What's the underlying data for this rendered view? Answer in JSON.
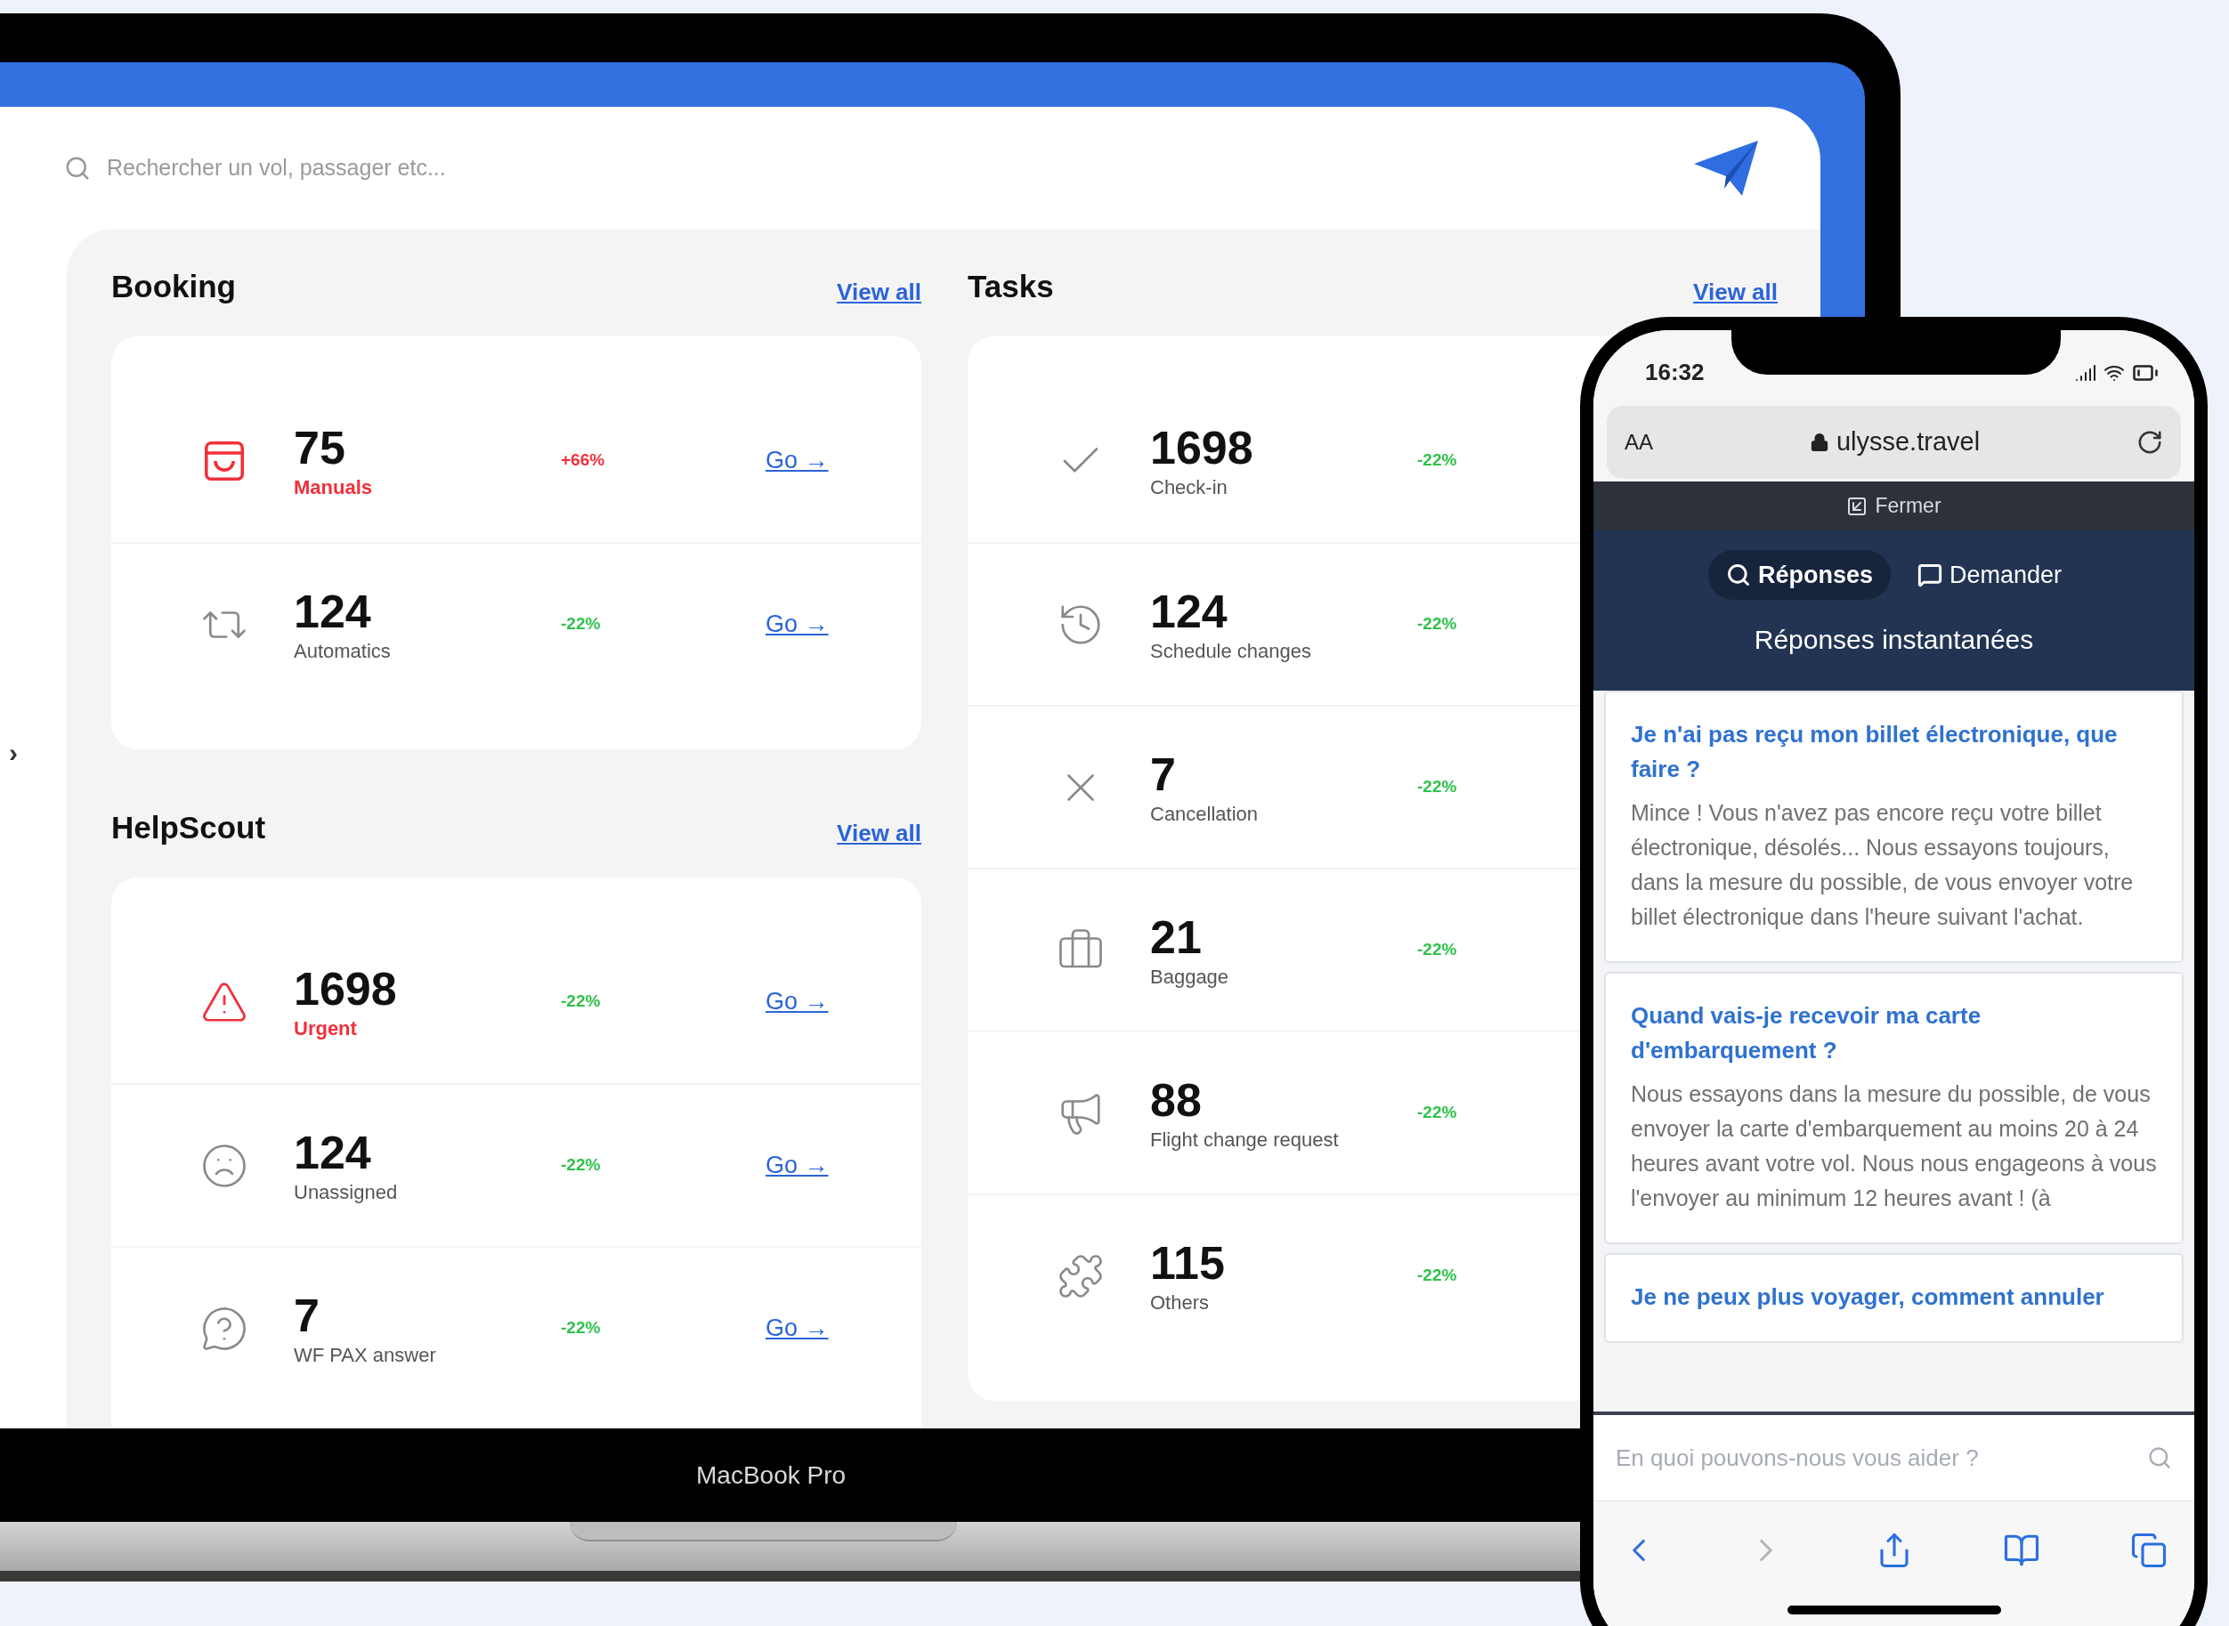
{
  "laptop": {
    "sidebar_toggle": "›",
    "search": {
      "placeholder": "Rechercher un vol, passager etc..."
    },
    "brand_label": "MacBook Pro",
    "columns": [
      [
        {
          "title": "Booking",
          "link": "View all",
          "rows": [
            {
              "value": "75",
              "label": "Manuals",
              "alert": true,
              "change": "+66%",
              "rising": true,
              "link": "Go →"
            },
            {
              "value": "124",
              "label": "Automatics",
              "alert": false,
              "change": "-22%",
              "rising": false,
              "link": "Go →"
            }
          ]
        },
        {
          "title": "HelpScout",
          "link": "View all",
          "rows": [
            {
              "value": "1698",
              "label": "Urgent",
              "alert": true,
              "change": "-22%",
              "rising": false,
              "link": "Go →"
            },
            {
              "value": "124",
              "label": "Unassigned",
              "alert": false,
              "change": "-22%",
              "rising": false,
              "link": "Go →"
            },
            {
              "value": "7",
              "label": "WF PAX answer",
              "alert": false,
              "change": "-22%",
              "rising": false,
              "link": "Go →"
            }
          ]
        }
      ],
      [
        {
          "title": "Tasks",
          "link": "View all",
          "rows": [
            {
              "value": "1698",
              "label": "Check-in",
              "alert": false,
              "change": "-22%",
              "rising": false
            },
            {
              "value": "124",
              "label": "Schedule changes",
              "alert": false,
              "change": "-22%",
              "rising": false
            },
            {
              "value": "7",
              "label": "Cancellation",
              "alert": false,
              "change": "-22%",
              "rising": false
            },
            {
              "value": "21",
              "label": "Baggage",
              "alert": false,
              "change": "-22%",
              "rising": false
            },
            {
              "value": "88",
              "label": "Flight change request",
              "alert": false,
              "change": "-22%",
              "rising": false
            },
            {
              "value": "115",
              "label": "Others",
              "alert": false,
              "change": "-22%",
              "rising": false
            }
          ]
        }
      ]
    ]
  },
  "phone": {
    "status_bar": {
      "time": "16:32"
    },
    "address_bar": {
      "text_size": "AA",
      "url": "ulysse.travel"
    },
    "close_button": "Fermer",
    "tabs": [
      {
        "label": "Réponses",
        "selected": true
      },
      {
        "label": "Demander",
        "selected": false
      }
    ],
    "title": "Réponses instantanées",
    "articles": [
      {
        "question": "Je n'ai pas reçu mon billet électronique, que faire ?",
        "answer": "Mince ! Vous n'avez pas encore reçu votre billet électronique, désolés... Nous essayons toujours, dans la mesure du possible, de vous envoyer votre billet électronique dans l'heure suivant l'achat."
      },
      {
        "question": "Quand vais-je recevoir ma carte d'embarquement ?",
        "answer": "Nous essayons dans la mesure du possible, de vous envoyer la carte d'embarquement au moins 20 à 24 heures avant votre vol. Nous nous engageons à vous l'envoyer au minimum 12 heures avant ! (à"
      },
      {
        "question": "Je ne peux plus voyager, comment annuler"
      }
    ],
    "search": {
      "placeholder": "En quoi pouvons-nous vous aider ?"
    }
  }
}
